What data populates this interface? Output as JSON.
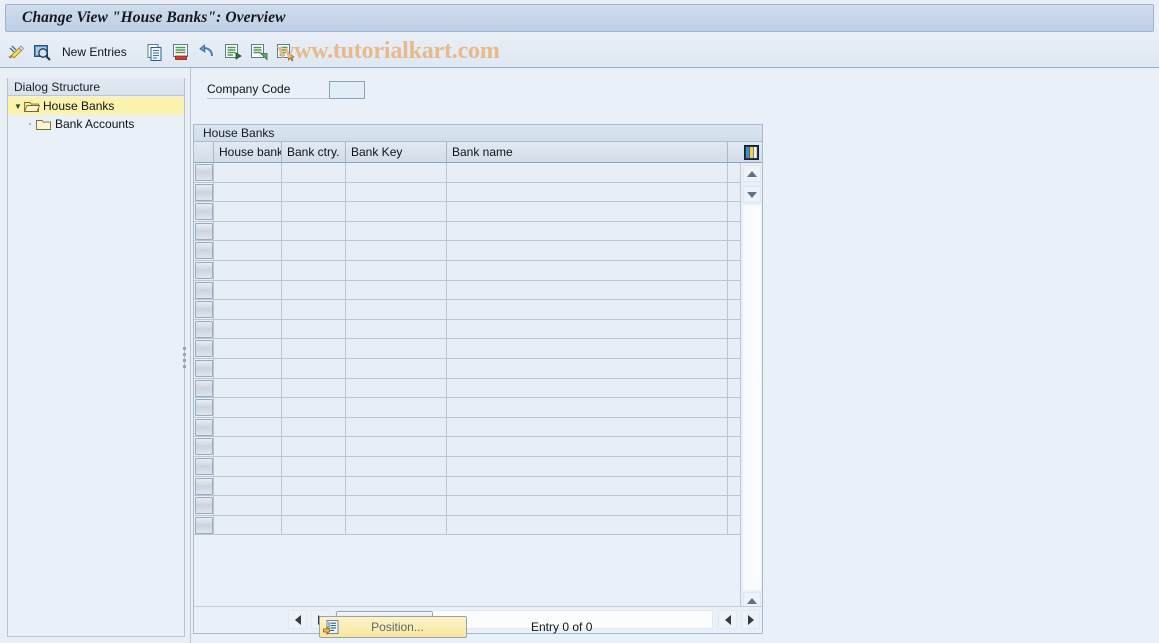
{
  "window": {
    "title": "Change View \"House Banks\": Overview"
  },
  "toolbar": {
    "icons_left": [
      {
        "name": "change-display-pencil-icon",
        "glyph": "pencil"
      },
      {
        "name": "display-details-magnifier-icon",
        "glyph": "magnifier"
      }
    ],
    "new_entries_label": "New Entries",
    "icons_right": [
      {
        "name": "copy-as-icon",
        "glyph": "copy"
      },
      {
        "name": "delete-icon",
        "glyph": "delete"
      },
      {
        "name": "undo-icon",
        "glyph": "undo"
      },
      {
        "name": "select-all-icon",
        "glyph": "select-all"
      },
      {
        "name": "deselect-all-icon",
        "glyph": "deselect-all"
      },
      {
        "name": "select-block-icon",
        "glyph": "select-block"
      }
    ]
  },
  "watermark": {
    "text": "www.tutorialkart.com"
  },
  "sidebar": {
    "header": "Dialog Structure",
    "items": [
      {
        "label": "House Banks",
        "selected": true,
        "level": 0,
        "expanded": true
      },
      {
        "label": "Bank Accounts",
        "selected": false,
        "level": 1,
        "expanded": false
      }
    ]
  },
  "form": {
    "company_code": {
      "label": "Company Code",
      "value": "",
      "placeholder": ""
    }
  },
  "table": {
    "caption": "House Banks",
    "columns": [
      {
        "key": "selector",
        "label": ""
      },
      {
        "key": "house_bank",
        "label": "House bank"
      },
      {
        "key": "bank_ctry",
        "label": "Bank ctry."
      },
      {
        "key": "bank_key",
        "label": "Bank Key"
      },
      {
        "key": "bank_name",
        "label": "Bank name"
      }
    ],
    "rows": [],
    "empty_row_count": 19,
    "config_icon": "table-settings-icon"
  },
  "footer": {
    "position_button_label": "Position...",
    "entry_status": "Entry 0 of 0"
  },
  "colors": {
    "title_bar": "#c5d5e8",
    "selection_yellow": "#fbf3ac",
    "watermark": "#e8b98a",
    "button_yellow": "#fbedb3",
    "panel_bg": "#eaf0f7"
  }
}
